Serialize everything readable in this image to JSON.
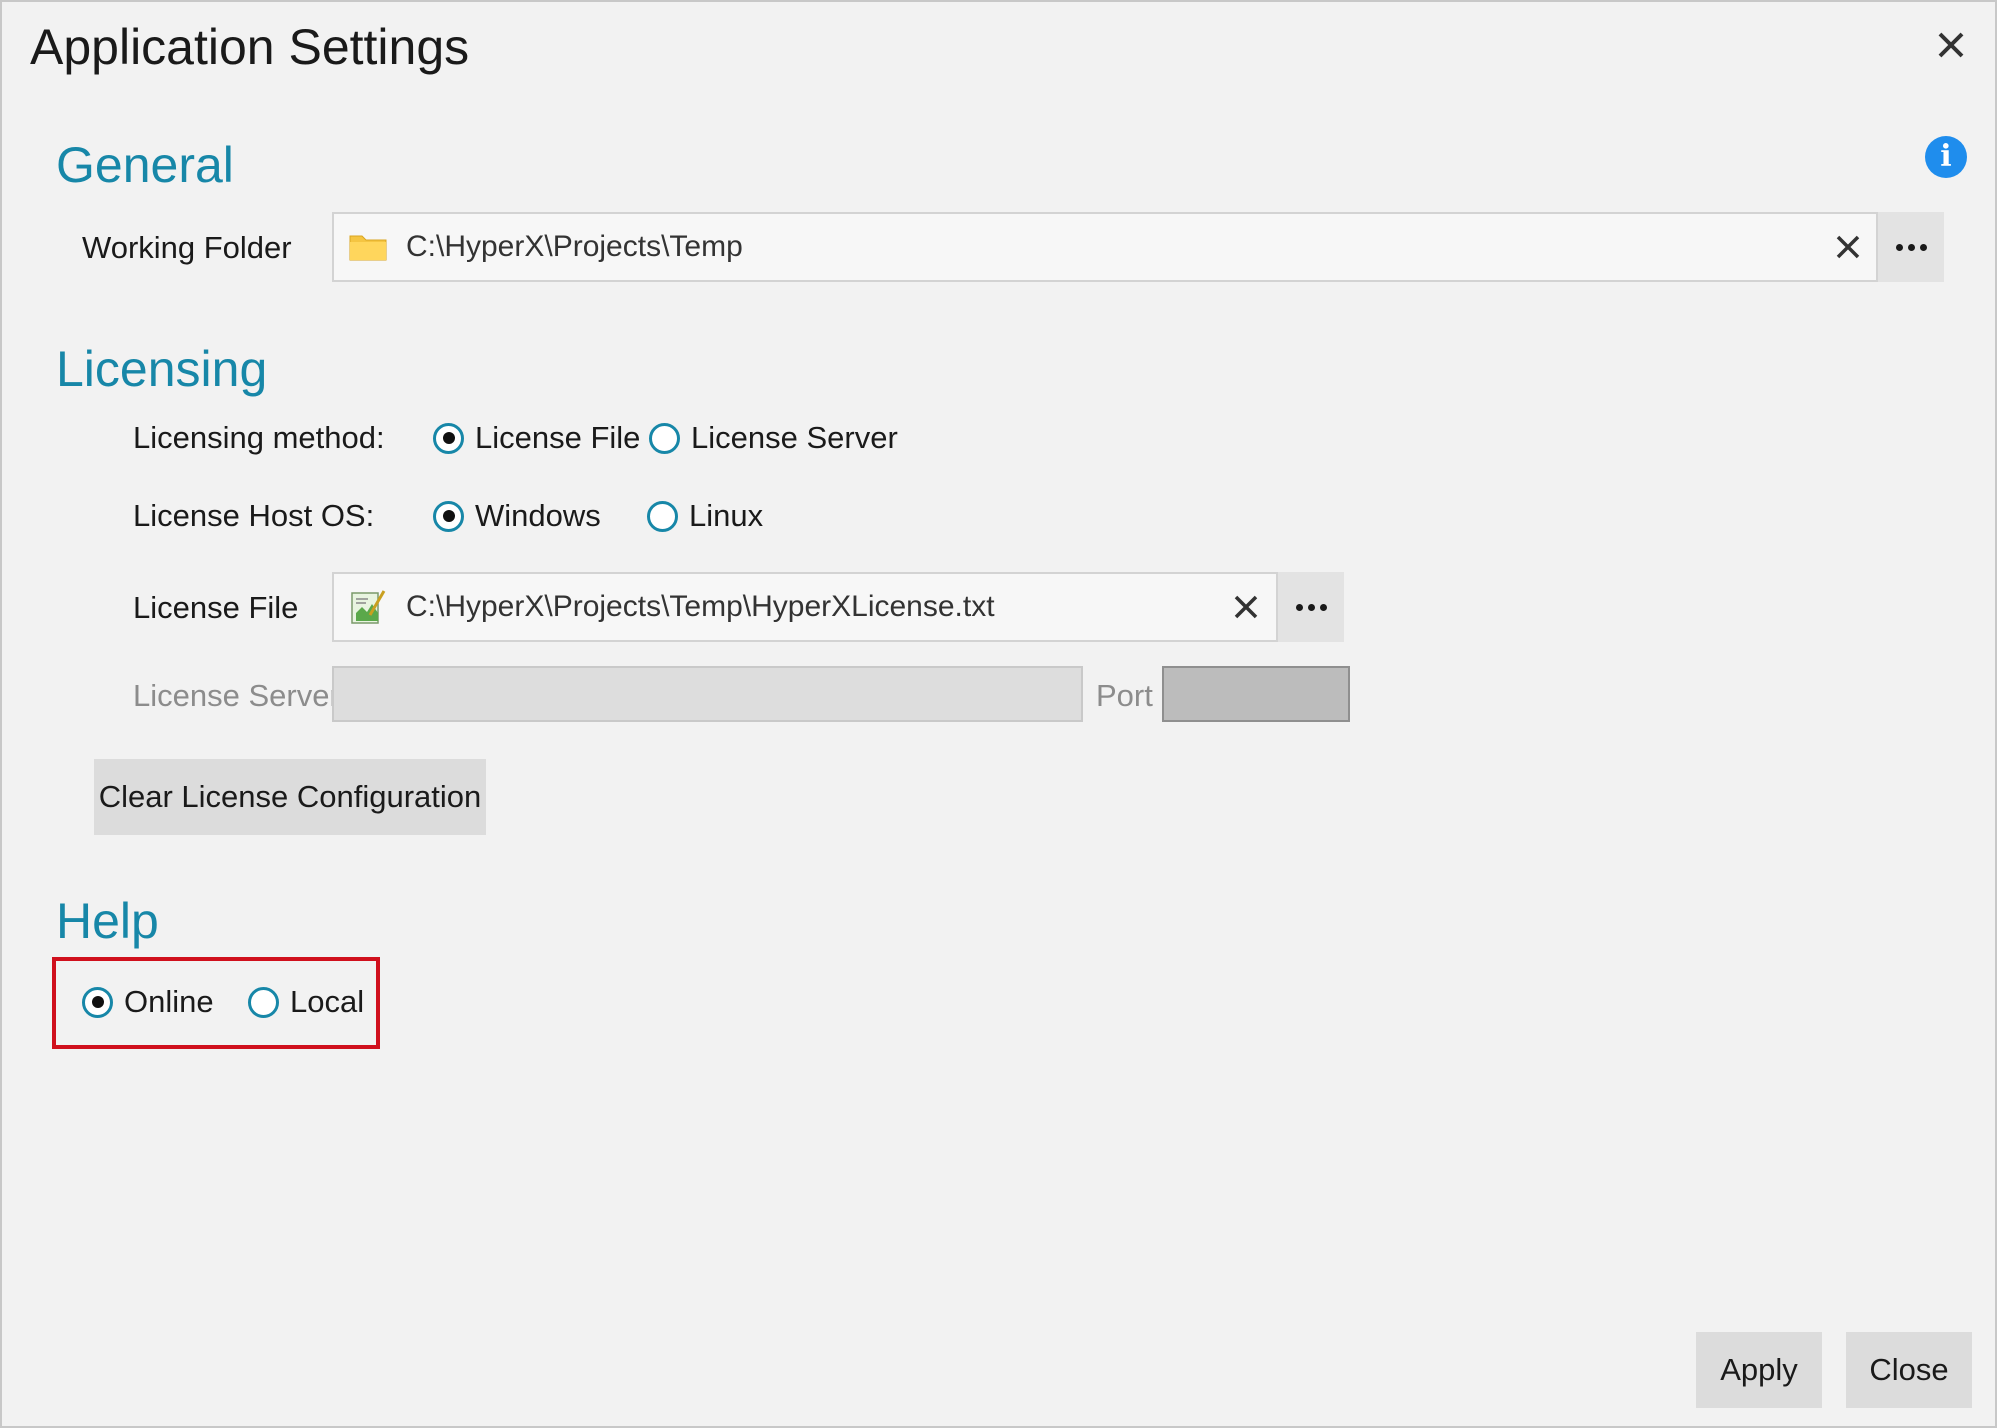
{
  "window": {
    "title": "Application Settings"
  },
  "general": {
    "heading": "General",
    "working_folder": {
      "label": "Working Folder",
      "value": "C:\\HyperX\\Projects\\Temp",
      "icon": "folder-icon"
    }
  },
  "licensing": {
    "heading": "Licensing",
    "method": {
      "label": "Licensing method:",
      "options": [
        "License File",
        "License Server"
      ],
      "selected": "License File"
    },
    "host_os": {
      "label": "License Host OS:",
      "options": [
        "Windows",
        "Linux"
      ],
      "selected": "Windows"
    },
    "license_file": {
      "label": "License File",
      "value": "C:\\HyperX\\Projects\\Temp\\HyperXLicense.txt",
      "icon": "text-file-icon"
    },
    "license_server": {
      "label": "License Server",
      "value": "",
      "port_label": "Port",
      "port_value": ""
    },
    "clear_button": "Clear License Configuration"
  },
  "help": {
    "heading": "Help",
    "options": [
      "Online",
      "Local"
    ],
    "selected": "Online"
  },
  "footer": {
    "apply_label": "Apply",
    "close_label": "Close"
  },
  "colors": {
    "accent": "#1787a8",
    "info": "#1f8ded",
    "highlight": "#d0101d"
  }
}
